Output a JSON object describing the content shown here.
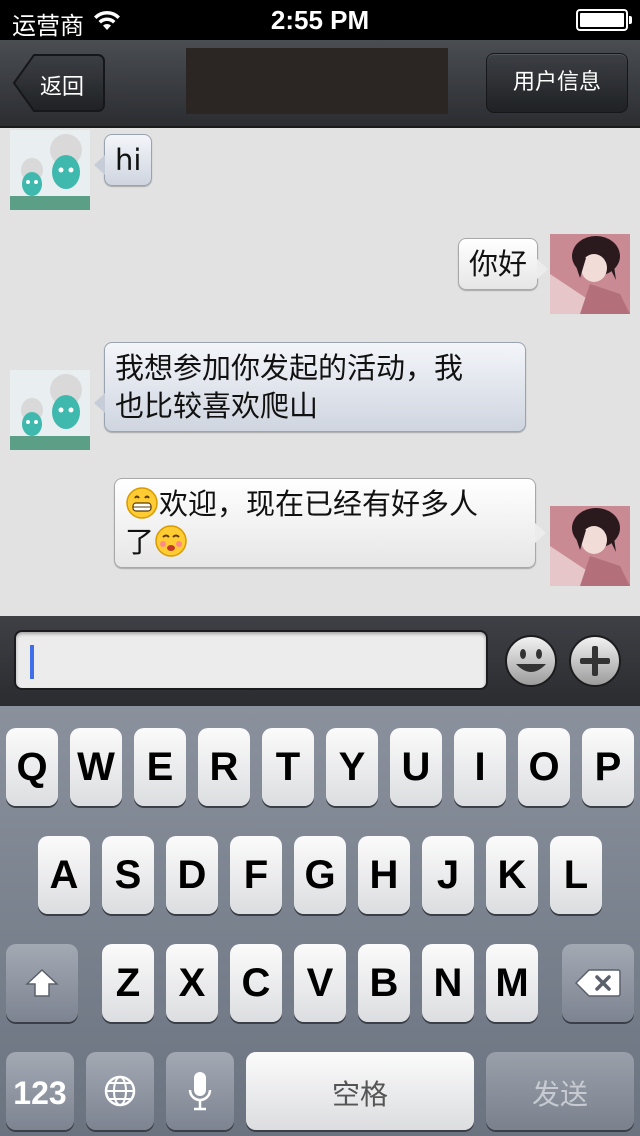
{
  "status_bar": {
    "carrier": "运营商",
    "time": "2:55 PM",
    "wifi_icon": "wifi-icon",
    "battery_icon": "battery-icon"
  },
  "nav": {
    "back_label": "返回",
    "user_info_label": "用户信息",
    "colors": {
      "bar": "#2b2d31",
      "title_block": "#2b2524"
    }
  },
  "messages": [
    {
      "direction": "incoming",
      "text": "hi"
    },
    {
      "direction": "outgoing",
      "text": "你好"
    },
    {
      "direction": "incoming",
      "lines": [
        "我想参加你发起的活动，我",
        "也比较喜欢爬山"
      ]
    },
    {
      "direction": "outgoing",
      "lines": [
        "欢迎，现在已经有好多人",
        "了"
      ],
      "emojis": [
        "grinning-face-icon",
        "blushing-face-icon"
      ]
    }
  ],
  "input": {
    "value": "",
    "emoji_button_icon": "smiley-icon",
    "plus_button_icon": "plus-icon"
  },
  "keyboard": {
    "row1": [
      "Q",
      "W",
      "E",
      "R",
      "T",
      "Y",
      "U",
      "I",
      "O",
      "P"
    ],
    "row2": [
      "A",
      "S",
      "D",
      "F",
      "G",
      "H",
      "J",
      "K",
      "L"
    ],
    "row3": [
      "Z",
      "X",
      "C",
      "V",
      "B",
      "N",
      "M"
    ],
    "numbers_label": "123",
    "space_label": "空格",
    "send_label": "发送",
    "shift_icon": "shift-icon",
    "delete_icon": "delete-icon",
    "globe_icon": "globe-icon",
    "mic_icon": "microphone-icon"
  }
}
